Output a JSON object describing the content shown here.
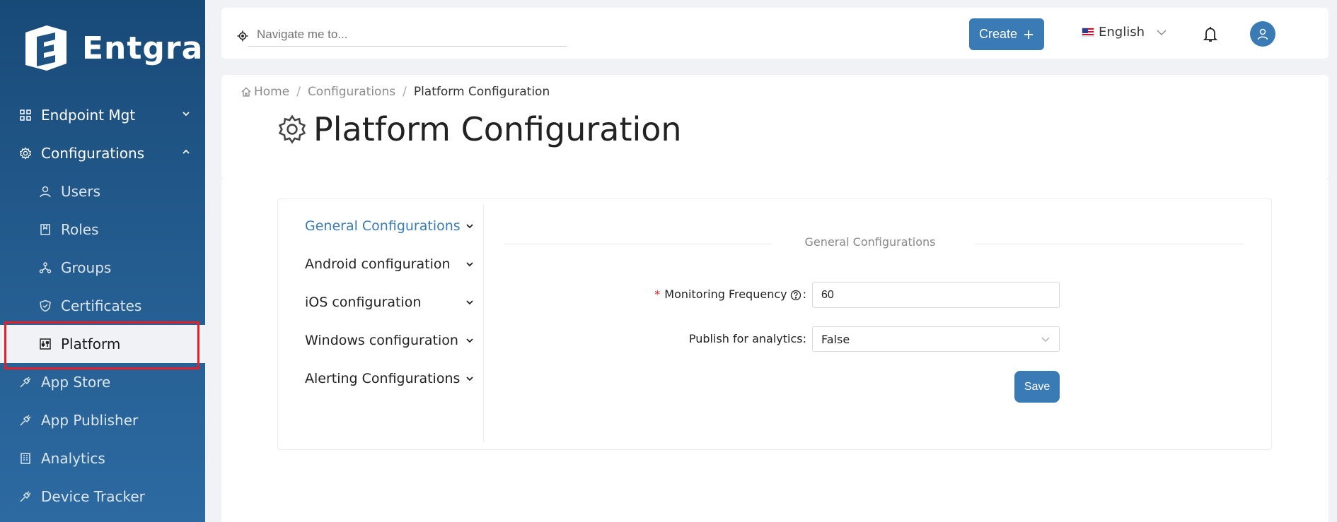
{
  "brand": {
    "name": "Entgra"
  },
  "sidebar": {
    "items": [
      {
        "label": "Endpoint Mgt",
        "icon": "grid-icon"
      },
      {
        "label": "Configurations",
        "icon": "gear-icon"
      },
      {
        "label": "App Store",
        "icon": "plug-icon"
      },
      {
        "label": "App Publisher",
        "icon": "plug-icon"
      },
      {
        "label": "Analytics",
        "icon": "building-icon"
      },
      {
        "label": "Device Tracker",
        "icon": "plug-icon"
      }
    ],
    "sub_items": [
      {
        "label": "Users",
        "icon": "user-icon"
      },
      {
        "label": "Roles",
        "icon": "book-icon"
      },
      {
        "label": "Groups",
        "icon": "cluster-icon"
      },
      {
        "label": "Certificates",
        "icon": "shield-icon"
      },
      {
        "label": "Platform",
        "icon": "sliders-icon"
      }
    ]
  },
  "topbar": {
    "search_placeholder": "Navigate me to...",
    "create_label": "Create",
    "language": "English"
  },
  "breadcrumb": {
    "home": "Home",
    "section": "Configurations",
    "current": "Platform Configuration"
  },
  "page": {
    "title": "Platform Configuration"
  },
  "config_menu": [
    "General Configurations",
    "Android configuration",
    "iOS configuration",
    "Windows configuration",
    "Alerting Configurations"
  ],
  "form": {
    "section_title": "General Configurations",
    "monitoring_label": "Monitoring Frequency",
    "monitoring_value": "60",
    "analytics_label": "Publish for analytics",
    "analytics_value": "False",
    "save_label": "Save"
  },
  "colors": {
    "accent": "#3a7bb6",
    "sidebar": "#1f5384",
    "required": "#e0202a"
  }
}
